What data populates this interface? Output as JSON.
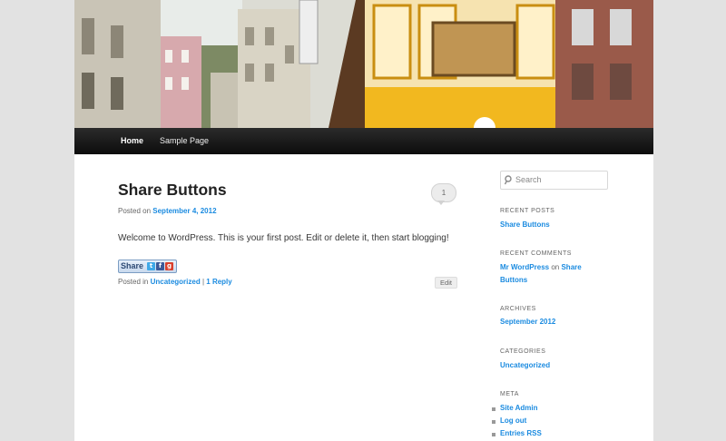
{
  "nav": {
    "items": [
      {
        "label": "Home",
        "current": true
      },
      {
        "label": "Sample Page",
        "current": false
      }
    ]
  },
  "post": {
    "title": "Share Buttons",
    "comment_count": "1",
    "posted_on_prefix": "Posted on",
    "date": "September 4, 2012",
    "body": "Welcome to WordPress. This is your first post. Edit or delete it, then start blogging!",
    "share_label": "Share",
    "share_icons": [
      "twitter-icon",
      "facebook-icon",
      "google-plus-icon"
    ],
    "posted_in_prefix": "Posted in",
    "category": "Uncategorized",
    "separator": "|",
    "reply": "1 Reply",
    "edit": "Edit"
  },
  "sidebar": {
    "search_placeholder": "Search",
    "recent_posts": {
      "title": "RECENT POSTS",
      "items": [
        "Share Buttons"
      ]
    },
    "recent_comments": {
      "title": "RECENT COMMENTS",
      "author": "Mr WordPress",
      "on": "on",
      "post": "Share Buttons"
    },
    "archives": {
      "title": "ARCHIVES",
      "items": [
        "September 2012"
      ]
    },
    "categories": {
      "title": "CATEGORIES",
      "items": [
        "Uncategorized"
      ]
    },
    "meta": {
      "title": "META",
      "items": [
        "Site Admin",
        "Log out",
        "Entries RSS"
      ]
    }
  },
  "colors": {
    "link": "#1b8be0",
    "nav_bg": "#111111",
    "page_bg": "#e2e2e2",
    "tram_yellow": "#f2b81f"
  }
}
